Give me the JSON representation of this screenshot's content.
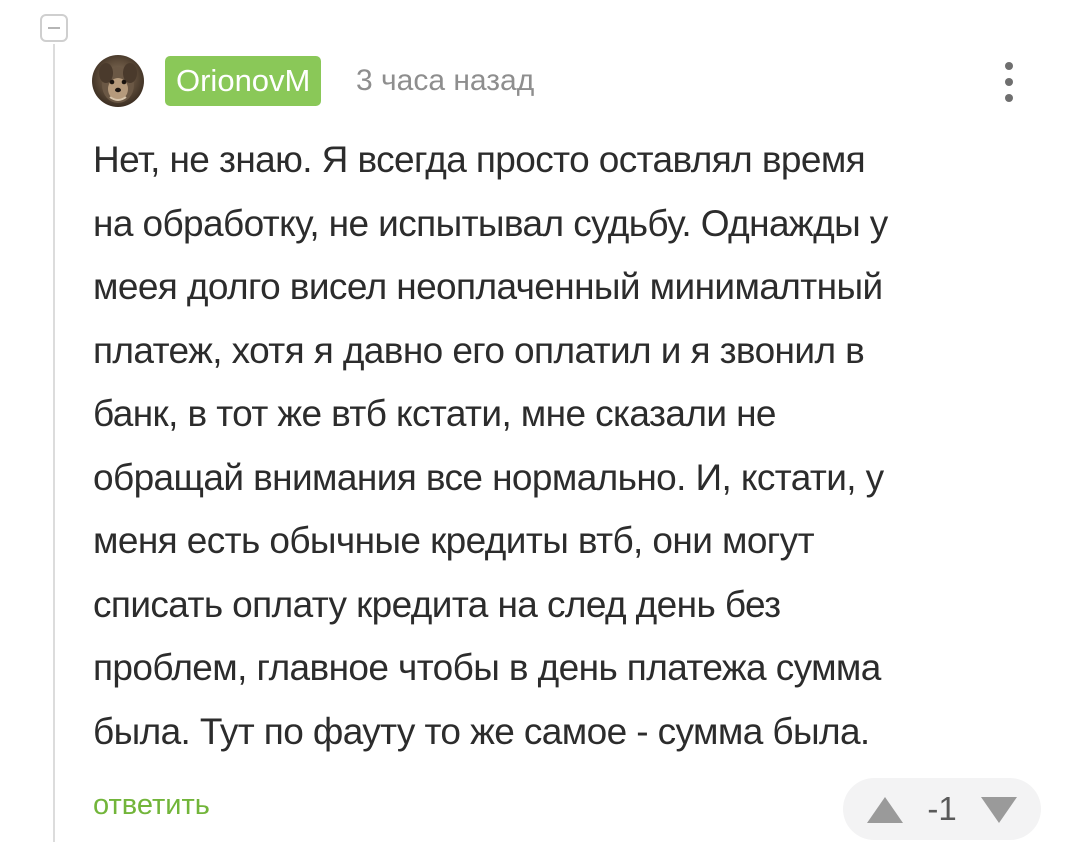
{
  "comment": {
    "author": "OrionovM",
    "timestamp": "3 часа назад",
    "text": "Нет, не знаю. Я всегда просто оставлял время\nна обработку, не испытывал судьбу. Однажды у\nмеея долго висел неоплаченный минималтный\nплатеж, хотя я давно его оплатил и я звонил в\nбанк, в тот же втб кстати, мне сказали не\nобращай внимания все нормально. И, кстати, у\nменя есть обычные кредиты втб, они могут\nсписать оплату кредита на след день без\nпроблем, главное чтобы в день платежа сумма\nбыла. Тут по фауту то же самое - сумма была.",
    "reply_label": "ответить",
    "rating": "-1"
  },
  "icons": {
    "collapse": "minus-square-icon",
    "menu": "vertical-dots-icon",
    "upvote": "triangle-up-icon",
    "downvote": "triangle-down-icon"
  },
  "colors": {
    "username_badge": "#8ac858",
    "reply_link": "#72b53a",
    "text": "#2c2c2c",
    "meta": "#8e8e8e"
  }
}
